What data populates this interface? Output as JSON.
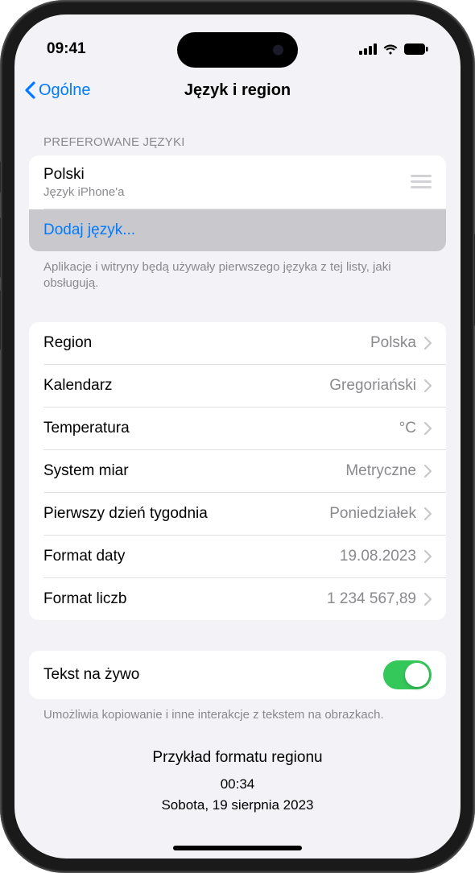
{
  "status": {
    "time": "09:41"
  },
  "nav": {
    "back": "Ogólne",
    "title": "Język i region"
  },
  "languages": {
    "header": "PREFEROWANE JĘZYKI",
    "primary": {
      "name": "Polski",
      "subtitle": "Język iPhone'a"
    },
    "add": "Dodaj język...",
    "footer": "Aplikacje i witryny będą używały pierwszego języka z tej listy, jaki obsługują."
  },
  "settings": {
    "region": {
      "label": "Region",
      "value": "Polska"
    },
    "calendar": {
      "label": "Kalendarz",
      "value": "Gregoriański"
    },
    "temperature": {
      "label": "Temperatura",
      "value": "°C"
    },
    "measurement": {
      "label": "System miar",
      "value": "Metryczne"
    },
    "first_day": {
      "label": "Pierwszy dzień tygodnia",
      "value": "Poniedziałek"
    },
    "date_format": {
      "label": "Format daty",
      "value": "19.08.2023"
    },
    "number_format": {
      "label": "Format liczb",
      "value": "1 234 567,89"
    }
  },
  "live_text": {
    "label": "Tekst na żywo",
    "footer": "Umożliwia kopiowanie i inne interakcje z tekstem na obrazkach.",
    "enabled": true
  },
  "example": {
    "title": "Przykład formatu regionu",
    "time": "00:34",
    "date": "Sobota, 19 sierpnia 2023"
  }
}
